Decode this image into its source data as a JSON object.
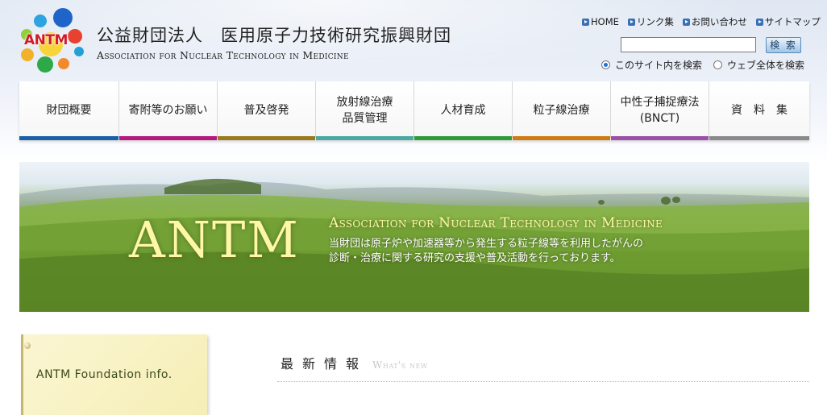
{
  "header": {
    "logo_text": "ANTM",
    "org_name_jp": "公益財団法人　医用原子力技術研究振興財団",
    "org_name_en": "Association for Nuclear Technology in Medicine"
  },
  "utility_links": [
    {
      "label": "HOME"
    },
    {
      "label": "リンク集"
    },
    {
      "label": "お問い合わせ"
    },
    {
      "label": "サイトマップ"
    }
  ],
  "search": {
    "value": "",
    "button_label": "検 索",
    "options": [
      {
        "label": "このサイト内を検索",
        "selected": true
      },
      {
        "label": "ウェブ全体を検索",
        "selected": false
      }
    ]
  },
  "nav": [
    {
      "label": "財団概要",
      "color": "#1b5fa8"
    },
    {
      "label": "寄附等のお願い",
      "color": "#b5177d"
    },
    {
      "label": "普及啓発",
      "color": "#9a7a1c"
    },
    {
      "label": "放射線治療\n品質管理",
      "color": "#4aa9a3"
    },
    {
      "label": "人材育成",
      "color": "#2f9a3a"
    },
    {
      "label": "粒子線治療",
      "color": "#d07a14"
    },
    {
      "label": "中性子捕捉療法\n(BNCT)",
      "color": "#9a4fa8"
    },
    {
      "label": "資　料　集",
      "color": "#8a8a8a"
    }
  ],
  "banner": {
    "title": "ANTM",
    "subtitle": "Association for Nuclear Technology in Medicine",
    "description": "当財団は原子炉や加速器等から発生する粒子線等を利用したがんの\n診断・治療に関する研究の支援や普及活動を行っております。"
  },
  "info_card": {
    "label": "ANTM Foundation info."
  },
  "news": {
    "heading_jp": "最新情報",
    "heading_en": "What's new"
  }
}
